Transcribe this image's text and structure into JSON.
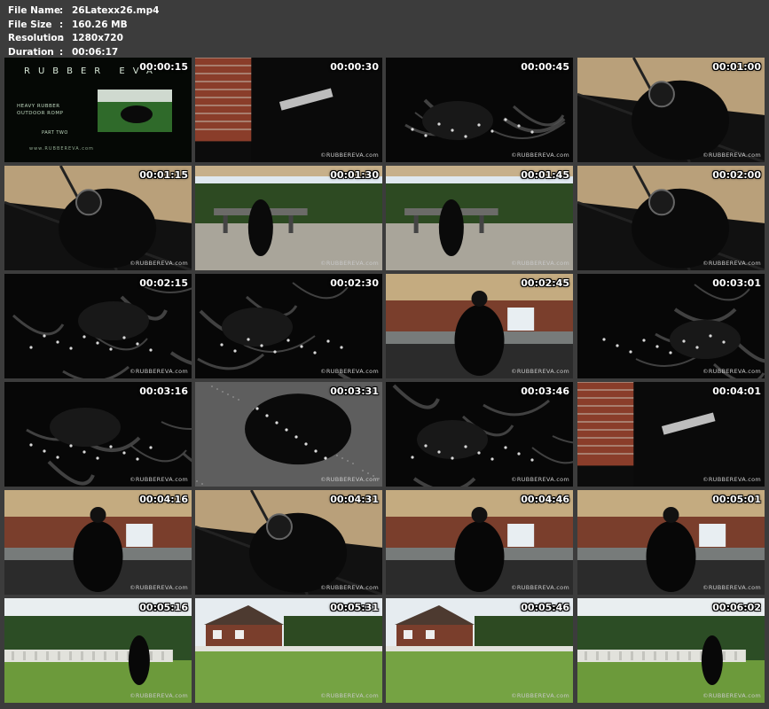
{
  "info": [
    {
      "label": "File Name",
      "value": "26Latexx26.mp4"
    },
    {
      "label": "File Size",
      "value": "160.26 MB"
    },
    {
      "label": "Resolution",
      "value": "1280x720"
    },
    {
      "label": "Duration",
      "value": "00:06:17"
    }
  ],
  "separator": ":",
  "title_card": {
    "brand": "RUBBER EVA",
    "line1": "HEAVY RUBBER",
    "line2": "OUTDOOR ROMP",
    "line3": "PART TWO",
    "url": "www.RUBBEREVA.com"
  },
  "watermark": "©RUBBEREVA.com",
  "thumbnails": [
    {
      "time": "00:00:15",
      "scene": "title"
    },
    {
      "time": "00:00:30",
      "scene": "brick"
    },
    {
      "time": "00:00:45",
      "scene": "dark"
    },
    {
      "time": "00:01:00",
      "scene": "umbrella"
    },
    {
      "time": "00:01:15",
      "scene": "umbrella"
    },
    {
      "time": "00:01:30",
      "scene": "garden"
    },
    {
      "time": "00:01:45",
      "scene": "garden"
    },
    {
      "time": "00:02:00",
      "scene": "umbrella"
    },
    {
      "time": "00:02:15",
      "scene": "dark"
    },
    {
      "time": "00:02:30",
      "scene": "dark"
    },
    {
      "time": "00:02:45",
      "scene": "patio"
    },
    {
      "time": "00:03:01",
      "scene": "dark"
    },
    {
      "time": "00:03:16",
      "scene": "dark"
    },
    {
      "time": "00:03:31",
      "scene": "stone"
    },
    {
      "time": "00:03:46",
      "scene": "dark"
    },
    {
      "time": "00:04:01",
      "scene": "brick"
    },
    {
      "time": "00:04:16",
      "scene": "patio"
    },
    {
      "time": "00:04:31",
      "scene": "umbrella"
    },
    {
      "time": "00:04:46",
      "scene": "patio"
    },
    {
      "time": "00:05:01",
      "scene": "patio"
    },
    {
      "time": "00:05:16",
      "scene": "lawn"
    },
    {
      "time": "00:05:31",
      "scene": "house"
    },
    {
      "time": "00:05:46",
      "scene": "house"
    },
    {
      "time": "00:06:02",
      "scene": "lawn"
    }
  ],
  "colors": {
    "background": "#3c3c3c",
    "text": "#ffffff"
  }
}
